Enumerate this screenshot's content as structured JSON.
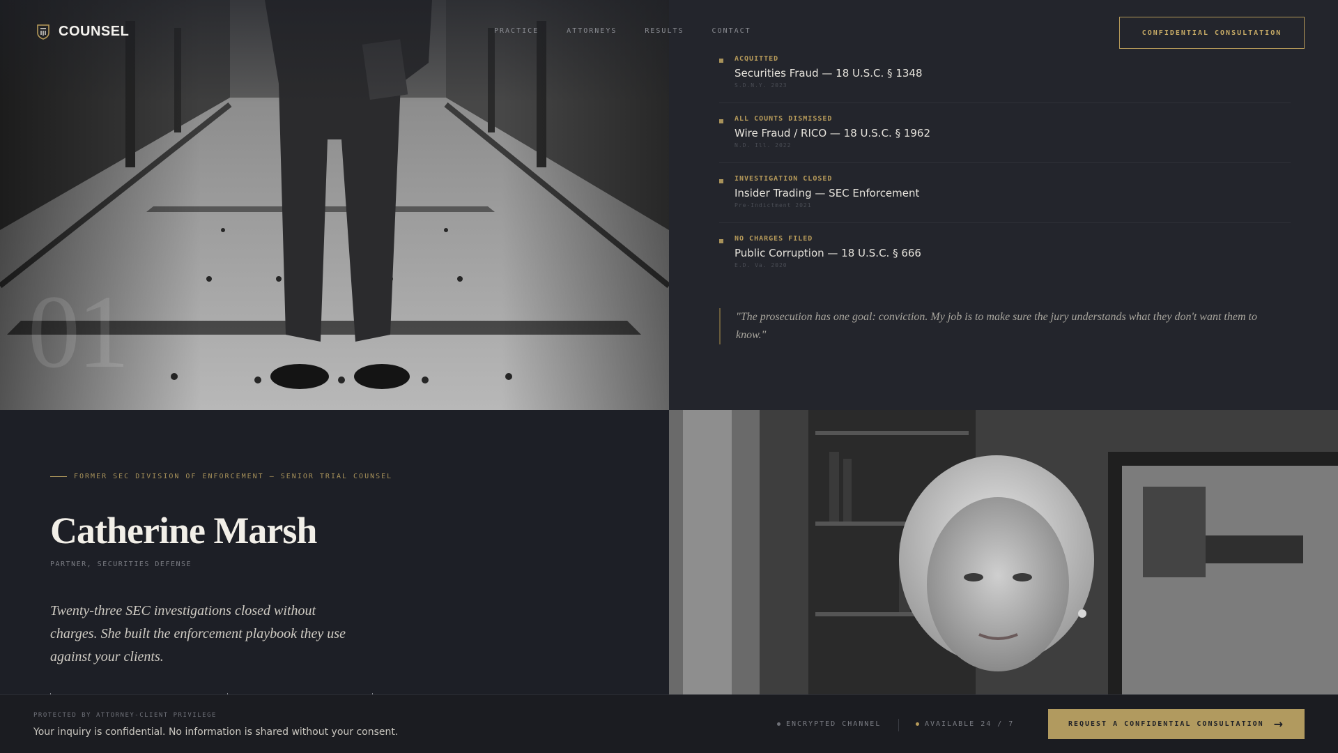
{
  "brand": {
    "name": "COUNSEL",
    "logo_icon": "shield-crest-icon"
  },
  "nav": {
    "items": [
      "PRACTICE",
      "ATTORNEYS",
      "RESULTS",
      "CONTACT"
    ]
  },
  "header": {
    "cta_label": "CONFIDENTIAL CONSULTATION"
  },
  "hero": {
    "index_label": "01"
  },
  "cases": [
    {
      "status": "ACQUITTED",
      "title": "Securities Fraud — 18 U.S.C. § 1348",
      "meta": "S.D.N.Y. 2023"
    },
    {
      "status": "ALL COUNTS DISMISSED",
      "title": "Wire Fraud / RICO — 18 U.S.C. § 1962",
      "meta": "N.D. Ill. 2022"
    },
    {
      "status": "INVESTIGATION CLOSED",
      "title": "Insider Trading — SEC Enforcement",
      "meta": "Pre-Indictment 2021"
    },
    {
      "status": "NO CHARGES FILED",
      "title": "Public Corruption — 18 U.S.C. § 666",
      "meta": "E.D. Va. 2020"
    }
  ],
  "quote": "\"The prosecution has one goal: conviction. My job is to make sure the jury understands what they don't want them to know.\"",
  "attorney": {
    "eyebrow": "FORMER SEC DIVISION OF ENFORCEMENT — SENIOR TRIAL COUNSEL",
    "name": "Catherine Marsh",
    "role": "PARTNER, SECURITIES DEFENSE",
    "bio": "Twenty-three SEC investigations closed without charges. She built the enforcement playbook they use against your clients."
  },
  "footer": {
    "eyebrow": "PROTECTED BY ATTORNEY-CLIENT PRIVILEGE",
    "text": "Your inquiry is confidential. No information is shared without your consent.",
    "indicator_1": "ENCRYPTED CHANNEL",
    "indicator_2": "AVAILABLE 24 / 7",
    "cta_label": "REQUEST A CONFIDENTIAL CONSULTATION",
    "cta_icon": "arrow-right-icon"
  },
  "colors": {
    "accent": "#b19a5f",
    "background": "#1d1f26",
    "panel": "#23252c",
    "available_pip": "#b79b5a",
    "encrypted_pip": "#6f7178"
  }
}
